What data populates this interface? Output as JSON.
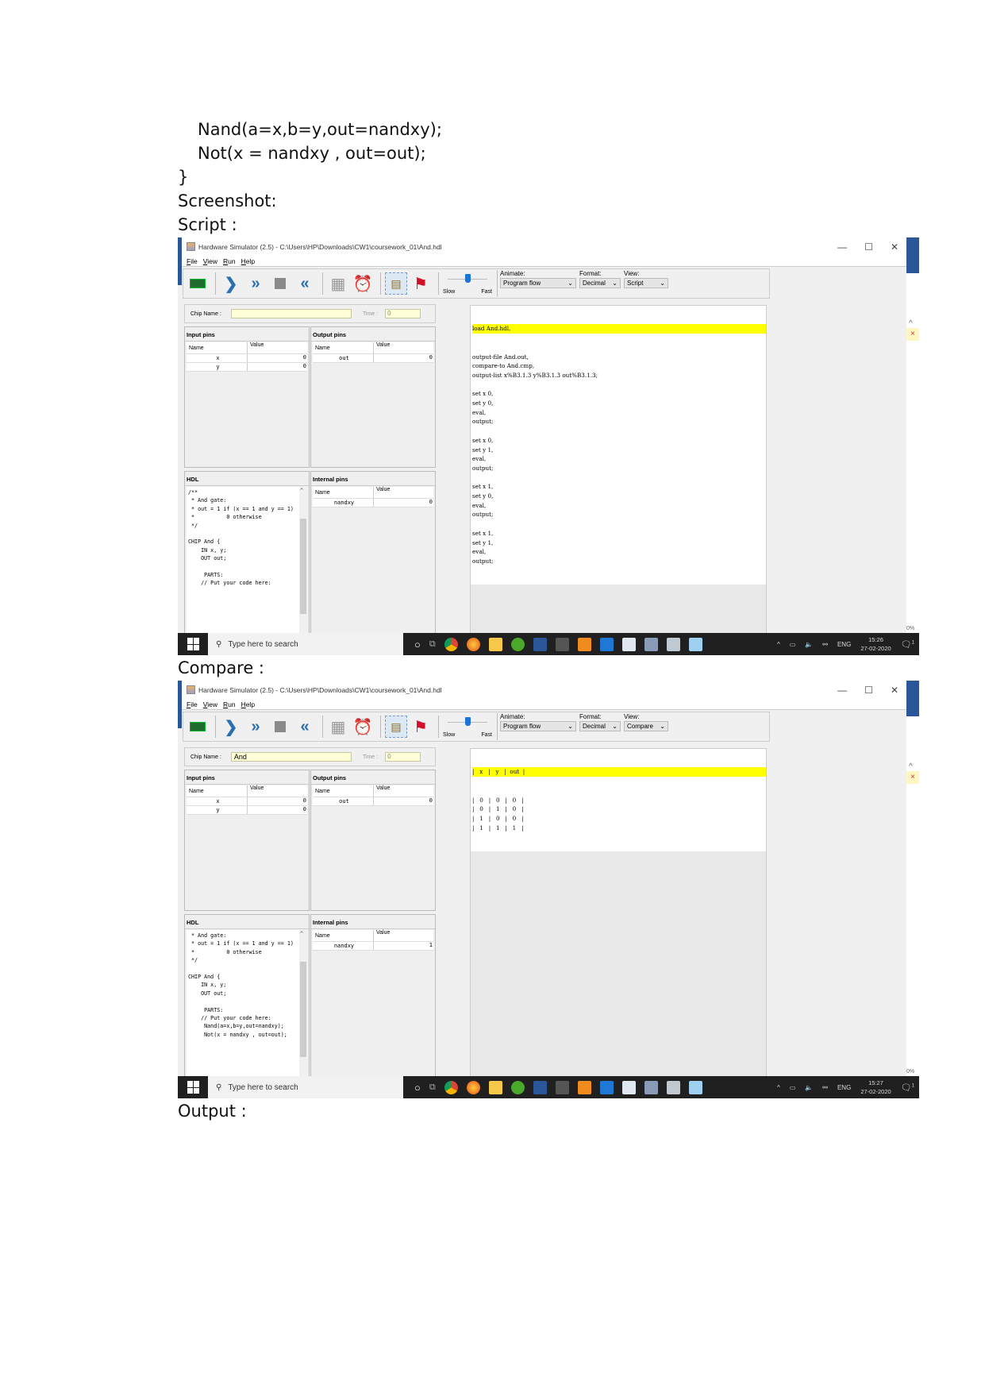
{
  "document": {
    "code_lines": [
      "Nand(a=x,b=y,out=nandxy);",
      "Not(x = nandxy , out=out);"
    ],
    "closing_brace": "}",
    "screenshot_label": "Screenshot:",
    "script_label": "Script :",
    "compare_label": "Compare :",
    "output_label": "Output :"
  },
  "windows": [
    {
      "title": "Hardware Simulator (2.5) - C:\\Users\\HP\\Downloads\\CW1\\coursework_01\\And.hdl",
      "menu": [
        "File",
        "View",
        "Run",
        "Help"
      ],
      "controls": {
        "minimize": "—",
        "maximize": "☐",
        "close": "✕"
      },
      "slider": {
        "slow": "Slow",
        "fast": "Fast",
        "speed_fraction": 0.5
      },
      "animate": {
        "label": "Animate:",
        "value": "Program flow"
      },
      "format": {
        "label": "Format:",
        "value": "Decimal"
      },
      "view": {
        "label": "View:",
        "value": "Script"
      },
      "chip_name_label": "Chip Name :",
      "chip_name_value": "",
      "time_label": "Time :",
      "time_value": "0",
      "input_pins": {
        "title": "Input pins",
        "headers": [
          "Name",
          "Value"
        ],
        "rows": [
          [
            "x",
            "0"
          ],
          [
            "y",
            "0"
          ]
        ]
      },
      "output_pins": {
        "title": "Output pins",
        "headers": [
          "Name",
          "Value"
        ],
        "rows": [
          [
            "out",
            "0"
          ]
        ]
      },
      "hdl": {
        "title": "HDL",
        "text": "/**\n * And gate:\n * out = 1 if (x == 1 and y == 1)\n *          0 otherwise\n */\n\nCHIP And {\n    IN x, y;\n    OUT out;\n\n     PARTS:\n    // Put your code here:"
      },
      "internal_pins": {
        "title": "Internal pins",
        "headers": [
          "Name",
          "Value"
        ],
        "rows": [
          [
            "nandxy",
            "0"
          ]
        ]
      },
      "main_highlight": "load And.hdl,",
      "main_text": "output-file And.out,\ncompare-to And.cmp,\noutput-list x%B3.1.3 y%B3.1.3 out%B3.1.3;\n\nset x 0,\nset y 0,\neval,\noutput;\n\nset x 0,\nset y 1,\neval,\noutput;\n\nset x 1,\nset y 0,\neval,\noutput;\n\nset x 1,\nset y 1,\neval,\noutput;",
      "taskbar": {
        "search_placeholder": "Type here to search",
        "lang": "ENG",
        "time": "15:26",
        "date": "27-02-2020",
        "notifications": "1"
      }
    },
    {
      "title": "Hardware Simulator (2.5) - C:\\Users\\HP\\Downloads\\CW1\\coursework_01\\And.hdl",
      "menu": [
        "File",
        "View",
        "Run",
        "Help"
      ],
      "controls": {
        "minimize": "—",
        "maximize": "☐",
        "close": "✕"
      },
      "slider": {
        "slow": "Slow",
        "fast": "Fast",
        "speed_fraction": 0.5
      },
      "animate": {
        "label": "Animate:",
        "value": "Program flow"
      },
      "format": {
        "label": "Format:",
        "value": "Decimal"
      },
      "view": {
        "label": "View:",
        "value": "Compare"
      },
      "chip_name_label": "Chip Name :",
      "chip_name_value": "And",
      "time_label": "Time :",
      "time_value": "0",
      "input_pins": {
        "title": "Input pins",
        "headers": [
          "Name",
          "Value"
        ],
        "rows": [
          [
            "x",
            "0"
          ],
          [
            "y",
            "0"
          ]
        ]
      },
      "output_pins": {
        "title": "Output pins",
        "headers": [
          "Name",
          "Value"
        ],
        "rows": [
          [
            "out",
            "0"
          ]
        ]
      },
      "hdl": {
        "title": "HDL",
        "text": " * And gate:\n * out = 1 if (x == 1 and y == 1)\n *          0 otherwise\n */\n\nCHIP And {\n    IN x, y;\n    OUT out;\n\n     PARTS:\n    // Put your code here:\n     Nand(a=x,b=y,out=nandxy);\n     Not(x = nandxy , out=out);"
      },
      "internal_pins": {
        "title": "Internal pins",
        "headers": [
          "Name",
          "Value"
        ],
        "rows": [
          [
            "nandxy",
            "1"
          ]
        ]
      },
      "main_highlight": "|   x   |   y   |  out  |",
      "main_text": "|   0   |   0   |   0   |\n|   0   |   1   |   0   |\n|   1   |   0   |   0   |\n|   1   |   1   |   1   |",
      "taskbar": {
        "search_placeholder": "Type here to search",
        "lang": "ENG",
        "time": "15:27",
        "date": "27-02-2020",
        "notifications": "1"
      }
    }
  ]
}
